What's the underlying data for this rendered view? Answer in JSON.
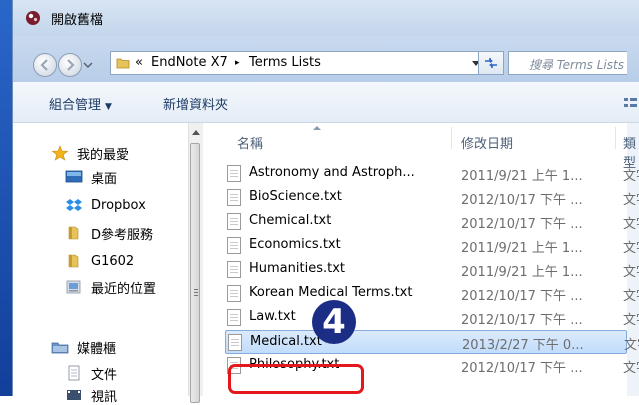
{
  "window": {
    "title": "開啟舊檔"
  },
  "address": {
    "crumb_prefix": "«",
    "crumbs": [
      "EndNote X7",
      "Terms Lists"
    ],
    "search_placeholder": "搜尋 Terms Lists"
  },
  "toolbar": {
    "organize": "組合管理",
    "new_folder": "新增資料夾"
  },
  "nav": {
    "favorites": "我的最愛",
    "items": [
      "桌面",
      "Dropbox",
      "D參考服務",
      "G1602",
      "最近的位置"
    ],
    "libraries": "媒體櫃",
    "library_items": [
      "文件",
      "視訊"
    ]
  },
  "columns": {
    "name": "名稱",
    "modified": "修改日期",
    "type": "類型"
  },
  "files": [
    {
      "name": "Astronomy and Astroph...",
      "date": "2011/9/21 上午 1...",
      "type": "文字"
    },
    {
      "name": "BioScience.txt",
      "date": "2012/10/17 下午 ...",
      "type": "文字"
    },
    {
      "name": "Chemical.txt",
      "date": "2012/10/17 下午 ...",
      "type": "文字"
    },
    {
      "name": "Economics.txt",
      "date": "2011/9/21 上午 1...",
      "type": "文字"
    },
    {
      "name": "Humanities.txt",
      "date": "2011/9/21 上午 1...",
      "type": "文字"
    },
    {
      "name": "Korean Medical Terms.txt",
      "date": "2012/10/17 下午 ...",
      "type": "文字"
    },
    {
      "name": "Law.txt",
      "date": "2012/10/17 下午 ...",
      "type": "文字"
    },
    {
      "name": "Medical.txt",
      "date": "2013/2/27 下午 0...",
      "type": "文字"
    },
    {
      "name": "Philosophy.txt",
      "date": "2012/10/17 下午 ...",
      "type": "文字"
    }
  ],
  "annotation": {
    "step": "4",
    "badge_color": "#1c2d86",
    "highlight_color": "#e4171c"
  }
}
